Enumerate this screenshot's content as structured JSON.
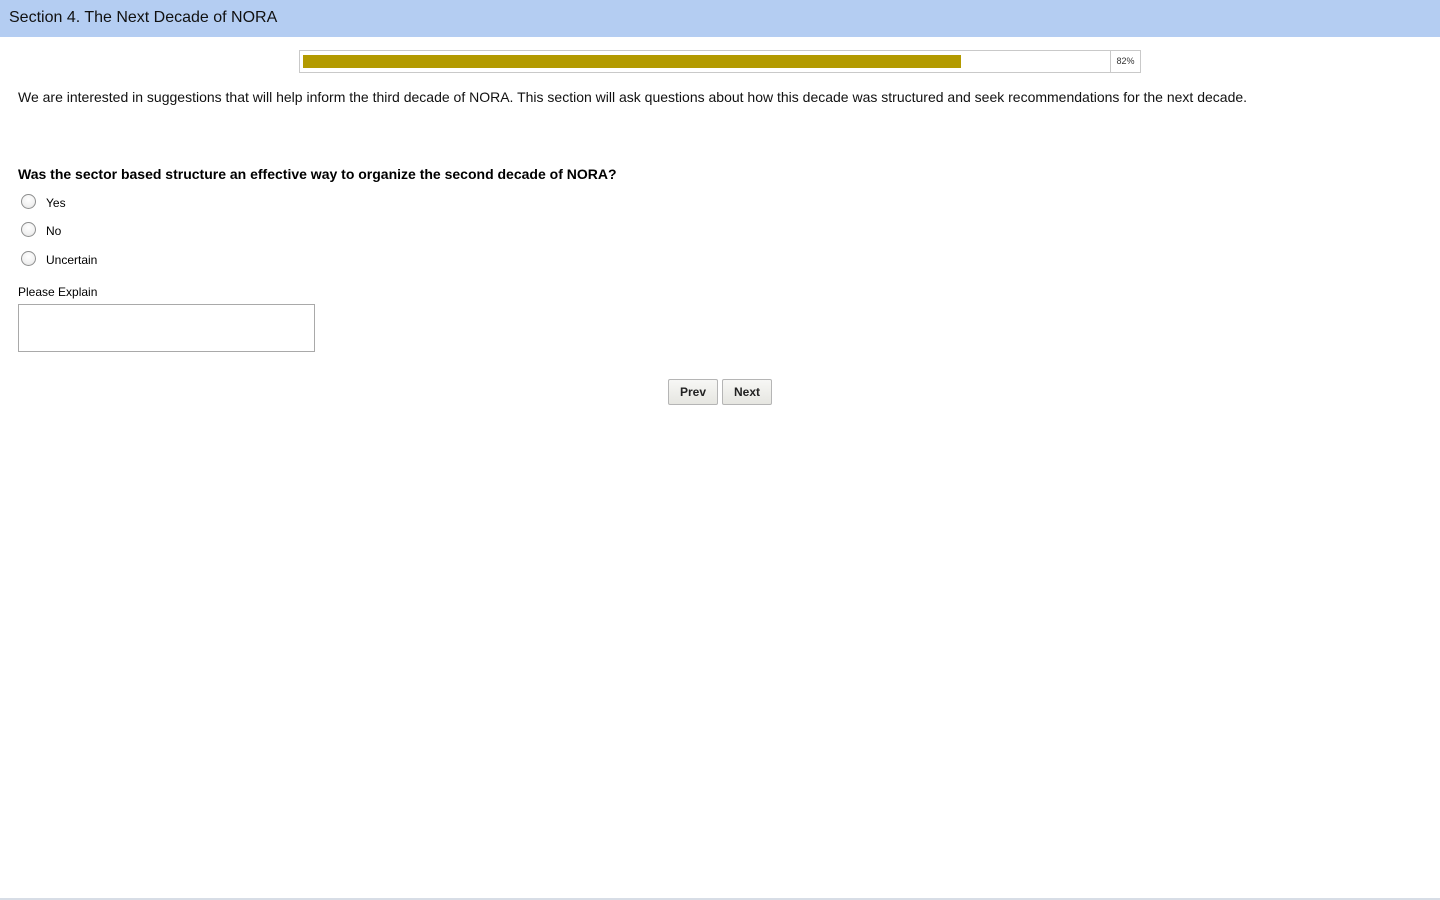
{
  "header": {
    "title": "Section 4. The Next Decade of NORA"
  },
  "progress": {
    "percent": 82,
    "label": "82%",
    "fill_color": "#b39a00"
  },
  "intro_text": "We are interested in suggestions that will help inform the third decade of NORA. This section will ask questions about how this decade was structured and seek recommendations for the next decade.",
  "question": {
    "text": "Was the sector based structure an effective way to organize the second decade of NORA?",
    "options": [
      "Yes",
      "No",
      "Uncertain"
    ],
    "selected": null
  },
  "explain": {
    "label": "Please Explain",
    "value": ""
  },
  "nav": {
    "prev_label": "Prev",
    "next_label": "Next"
  },
  "colors": {
    "header_bg": "#b4cdf2",
    "progress_fill": "#b39a00"
  }
}
